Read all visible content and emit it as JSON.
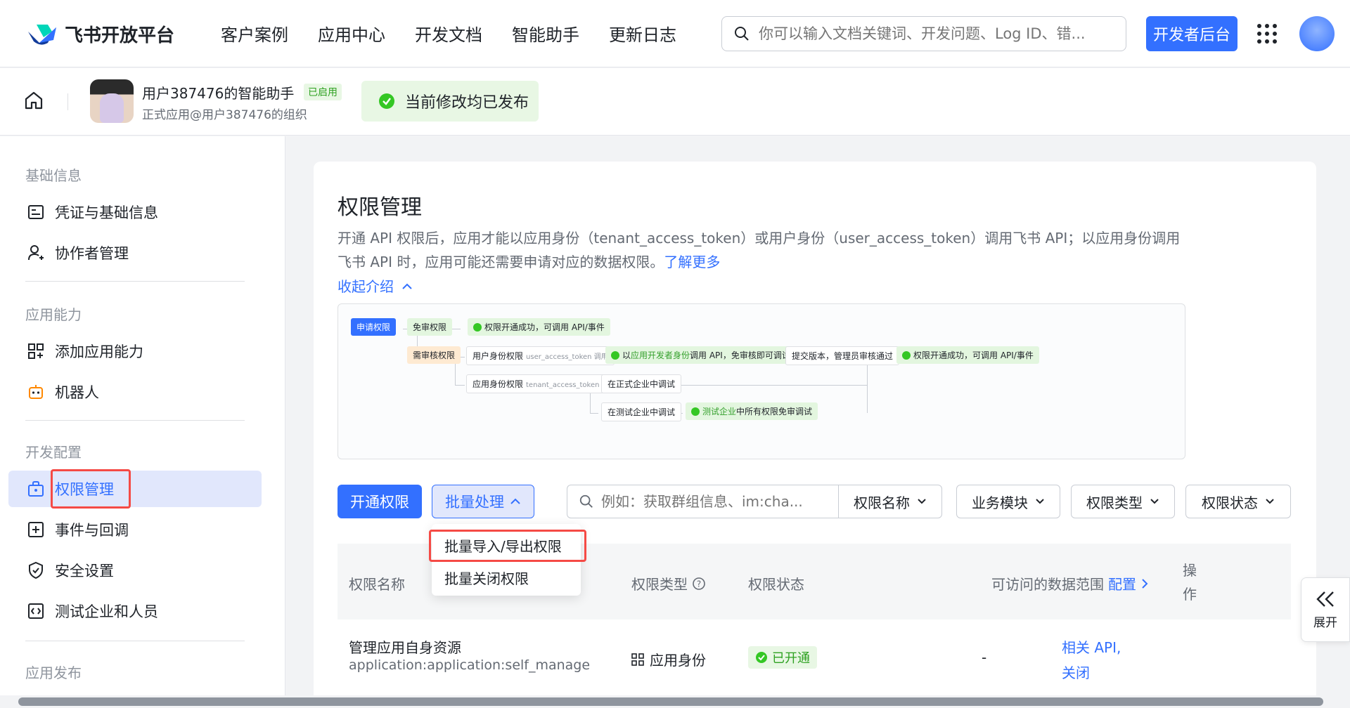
{
  "topnav": {
    "logo_text": "飞书开放平台",
    "links": [
      "客户案例",
      "应用中心",
      "开发文档",
      "智能助手",
      "更新日志"
    ],
    "search_placeholder": "你可以输入文档关键词、开发问题、Log ID、错...",
    "dev_button": "开发者后台"
  },
  "subheader": {
    "app_name": "用户387476的智能助手",
    "app_badge": "已启用",
    "app_org": "正式应用@用户387476的组织",
    "publish_status": "当前修改均已发布"
  },
  "sidebar": {
    "groups": [
      "基础信息",
      "应用能力",
      "开发配置",
      "应用发布"
    ],
    "items": [
      {
        "label": "凭证与基础信息",
        "icon": "credential-icon"
      },
      {
        "label": "协作者管理",
        "icon": "user-add-icon"
      },
      {
        "label": "添加应用能力",
        "icon": "apps-add-icon"
      },
      {
        "label": "机器人",
        "icon": "robot-icon"
      },
      {
        "label": "权限管理",
        "icon": "permission-icon"
      },
      {
        "label": "事件与回调",
        "icon": "event-icon"
      },
      {
        "label": "安全设置",
        "icon": "shield-icon"
      },
      {
        "label": "测试企业和人员",
        "icon": "code-icon"
      }
    ]
  },
  "main": {
    "title": "权限管理",
    "description": "开通 API 权限后，应用才能以应用身份（tenant_access_token）或用户身份（user_access_token）调用飞书 API；以应用身份调用飞书 API 时，应用可能还需要申请对应的数据权限。",
    "learn_more": "了解更多",
    "collapse": "收起介绍",
    "diagram": {
      "apply": "申请权限",
      "free": "免审权限",
      "free_result": "权限开通成功，可调用 API/事件",
      "review": "需审核权限",
      "user_perm": "用户身份权限",
      "user_perm_token": "user_access_token 调用",
      "dev_identity_prefix": "以",
      "dev_identity_green": "应用开发者身份",
      "dev_identity_suffix": "调用 API，免审核即可调试",
      "submit": "提交版本，管理员审核通过",
      "final_result": "权限开通成功，可调用 API/事件",
      "app_perm": "应用身份权限",
      "app_perm_token": "tenant_access_token 调用",
      "prod_debug": "在正式企业中调试",
      "test_debug": "在测试企业中调试",
      "test_free_green": "测试企业",
      "test_free_suffix": "中所有权限免审调试"
    },
    "toolbar": {
      "open_button": "开通权限",
      "batch_button": "批量处理",
      "search_placeholder": "例如：获取群组信息、im:cha...",
      "filter_name": "权限名称",
      "filter_module": "业务模块",
      "filter_type": "权限类型",
      "filter_status": "权限状态"
    },
    "batch_menu": [
      "批量导入/导出权限",
      "批量关闭权限"
    ],
    "table": {
      "headers": {
        "name": "权限名称",
        "type": "权限类型",
        "status": "权限状态",
        "scope": "可访问的数据范围",
        "scope_link": "配置",
        "op_line1": "操",
        "op_line2": "作"
      },
      "rows": [
        {
          "name": "管理应用自身资源",
          "code": "application:application:self_manage",
          "type": "应用身份",
          "status": "已开通",
          "scope": "-",
          "op_line1": "相关 API,",
          "op_line2": "关闭"
        }
      ]
    },
    "expand_label": "展开"
  },
  "colors": {
    "accent": "#3370ff",
    "success": "#34c724",
    "highlight_box": "#f54a45"
  }
}
